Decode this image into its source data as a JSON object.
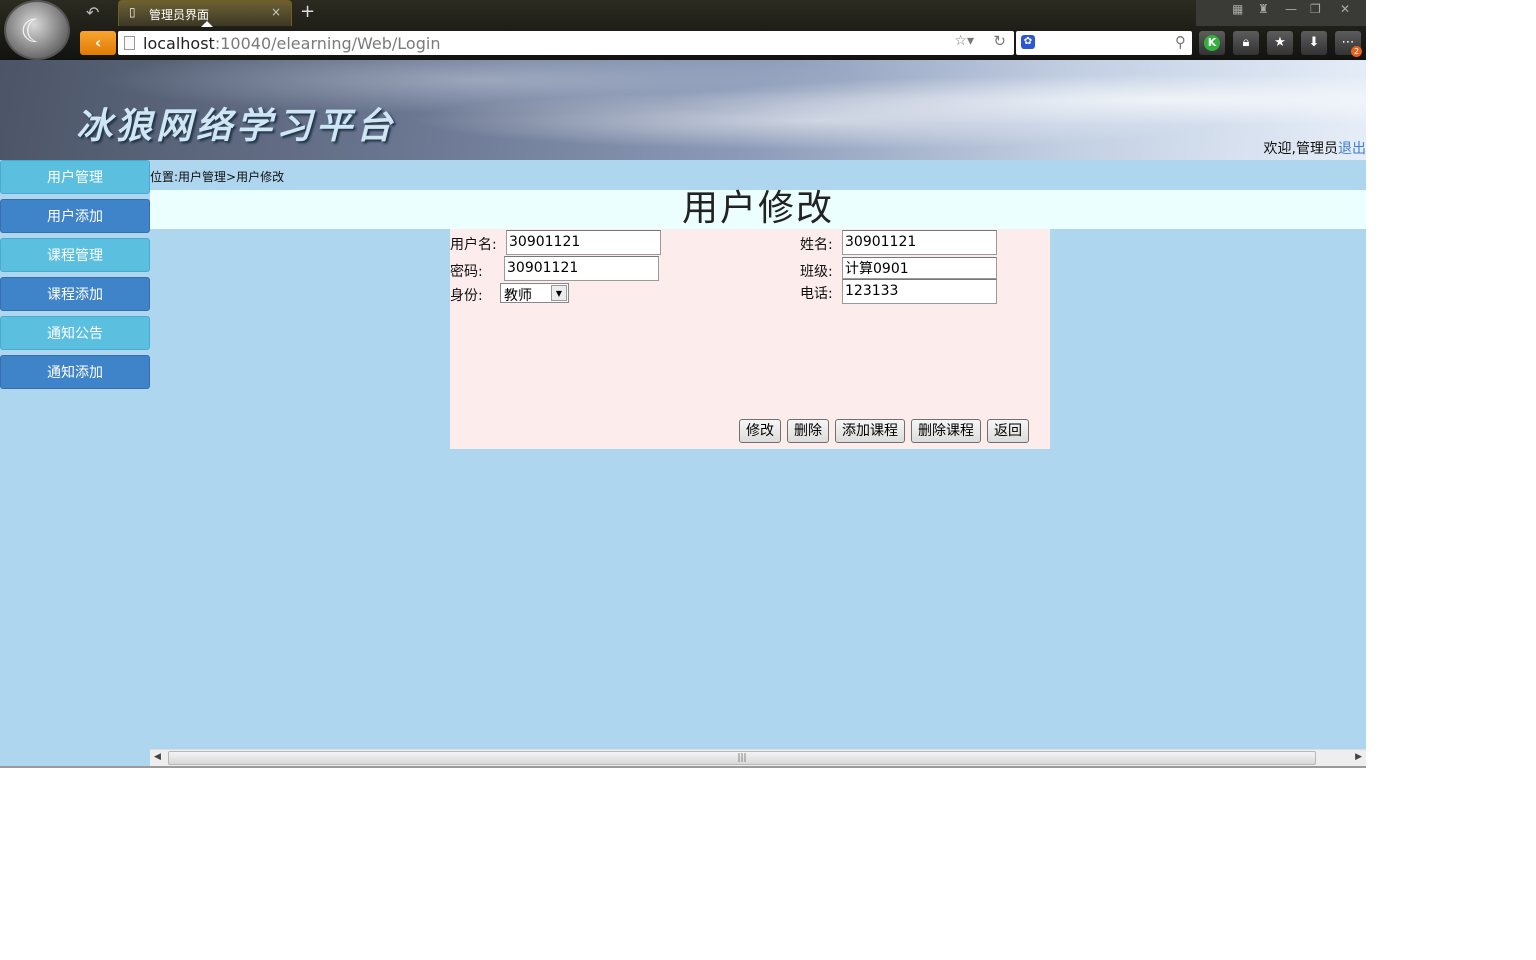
{
  "browser": {
    "tab_title": "管理员界面",
    "url_host": "localhost",
    "url_rest": ":10040/elearning/Web/Login",
    "new_tab": "+",
    "tab_close": "×",
    "badge_count": "2"
  },
  "banner": {
    "title": "冰狼网络学习平台",
    "welcome": "欢迎,管理员",
    "logout": "退出"
  },
  "sidebar": {
    "items": [
      {
        "label": "用户管理"
      },
      {
        "label": "用户添加"
      },
      {
        "label": "课程管理"
      },
      {
        "label": "课程添加"
      },
      {
        "label": "通知公告"
      },
      {
        "label": "通知添加"
      }
    ]
  },
  "breadcrumb": "位置:用户管理>用户修改",
  "page_title": "用户修改",
  "form": {
    "username_label": "用户名:",
    "username_value": "30901121",
    "password_label": "密码:",
    "password_value": "30901121",
    "role_label": "身份:",
    "role_value": "教师",
    "name_label": "姓名:",
    "name_value": "30901121",
    "class_label": "班级:",
    "class_value": "计算0901",
    "phone_label": "电话:",
    "phone_value": "123133"
  },
  "buttons": {
    "modify": "修改",
    "delete": "删除",
    "add_course": "添加课程",
    "delete_course": "删除课程",
    "back": "返回"
  },
  "colors": {
    "page_bg": "#aed6ee",
    "side_light": "#5bbfe0",
    "side_dark": "#3f83c8",
    "title_bar": "#eafffe",
    "form_bg": "#fdecec",
    "logout_link": "#3f7fd6"
  }
}
